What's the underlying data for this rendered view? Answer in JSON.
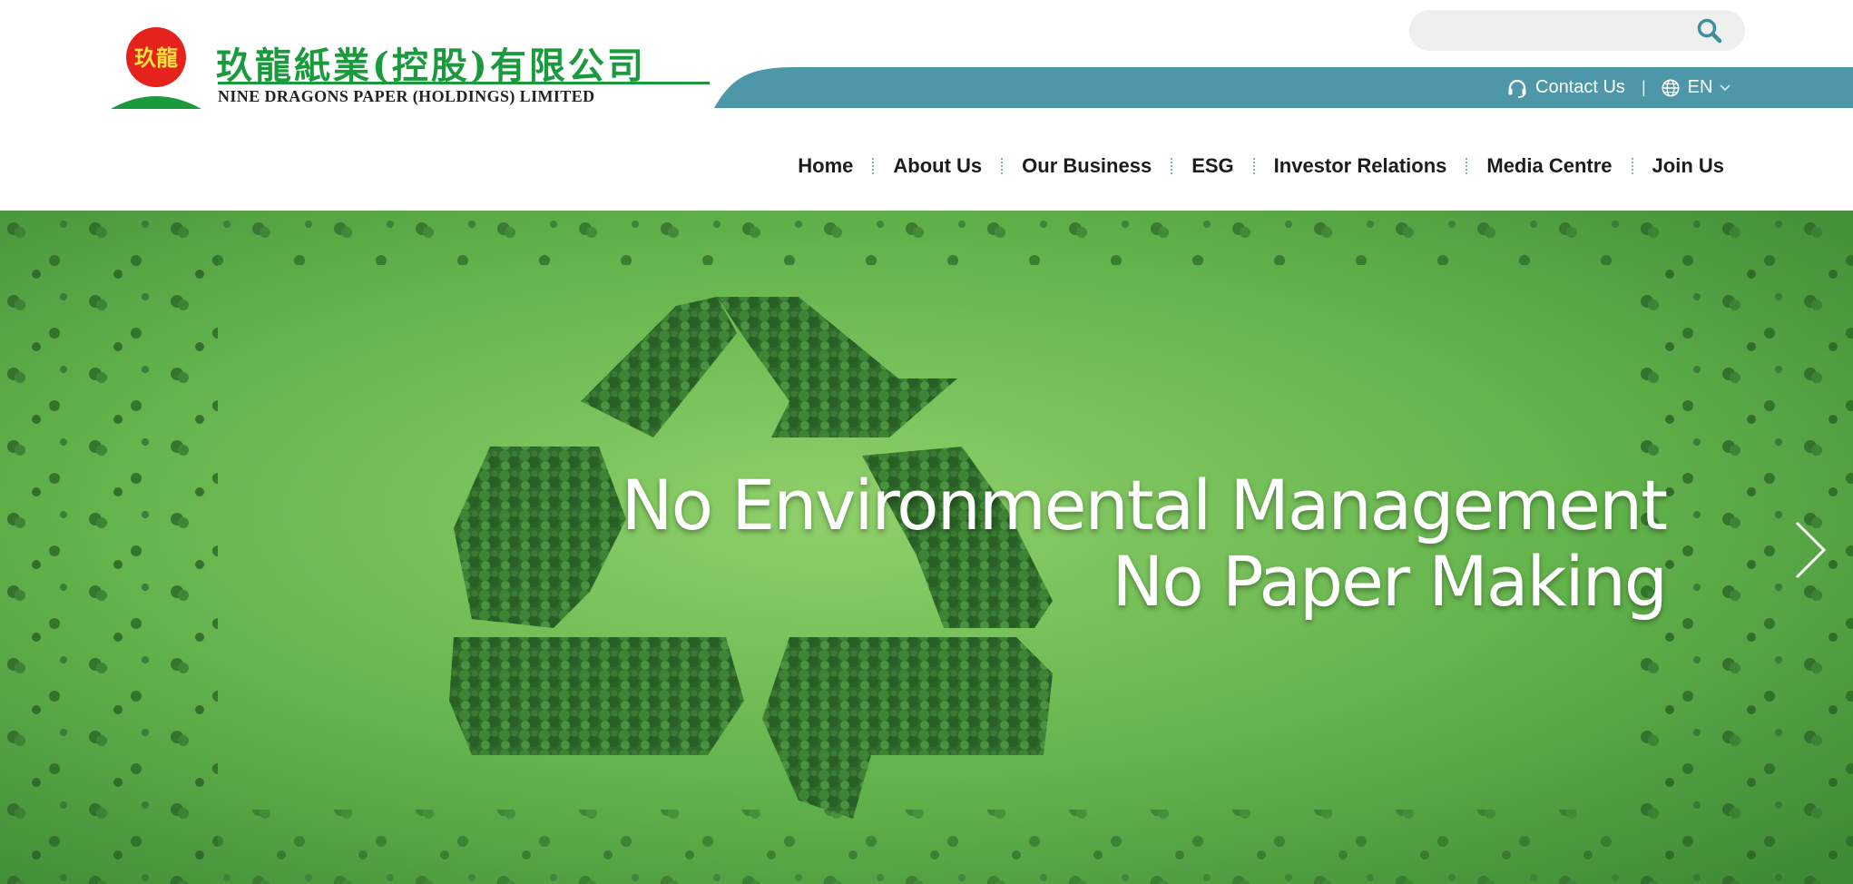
{
  "logo": {
    "chinese_name": "玖龍紙業(控股)有限公司",
    "english_name": "NINE DRAGONS PAPER (HOLDINGS) LIMITED",
    "emblem_text": "玖龍",
    "icon": "dragon-emblem-icon"
  },
  "search": {
    "placeholder": "",
    "icon": "search-icon"
  },
  "topbar": {
    "contact_label": "Contact Us",
    "contact_icon": "headset-icon",
    "separator": "|",
    "language_label": "EN",
    "language_icon": "globe-icon",
    "language_chevron": "chevron-down-icon"
  },
  "nav": {
    "items": [
      {
        "label": "Home"
      },
      {
        "label": "About Us"
      },
      {
        "label": "Our Business"
      },
      {
        "label": "ESG"
      },
      {
        "label": "Investor Relations"
      },
      {
        "label": "Media Centre"
      },
      {
        "label": "Join Us"
      }
    ]
  },
  "hero": {
    "line1": "No Environmental Management",
    "line2": "No Paper Making",
    "next_icon": "chevron-right-icon",
    "graphic_icon": "recycle-forest-icon"
  },
  "colors": {
    "brand_green": "#1a9a3c",
    "teal_bar": "#4e97a8",
    "emblem_red": "#e5231c",
    "emblem_yellow": "#ffe23a",
    "grass": "#5fb04a",
    "forest": "#2f6b2a"
  }
}
